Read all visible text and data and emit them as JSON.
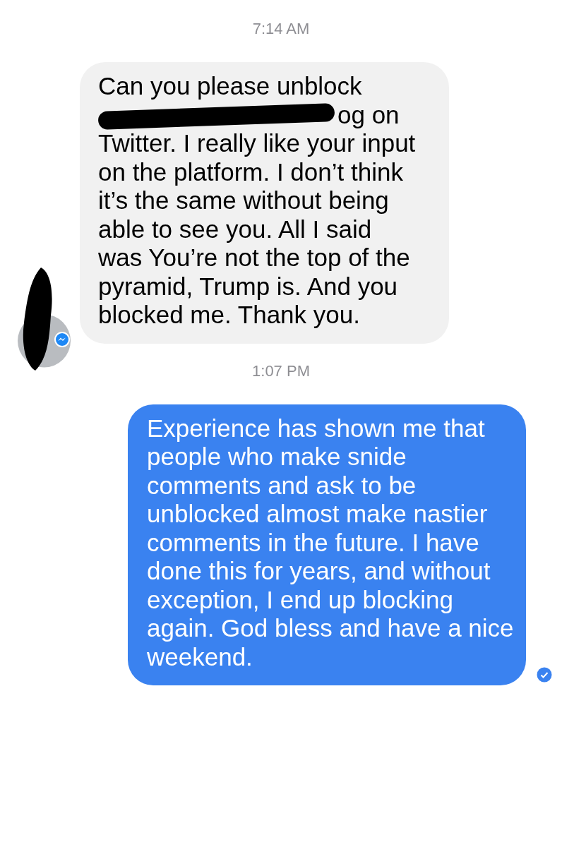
{
  "messages": [
    {
      "kind": "time",
      "text": "7:14 AM"
    },
    {
      "kind": "received",
      "text_before": "Can you please unblock",
      "redacted": true,
      "text_after": "og on Twitter. I really like your input on the platform. I don’t think it’s the same without being able to see you. All I said was You’re not the top of the pyramid, Trump is. And you blocked me. Thank you.",
      "avatar_redacted": true
    },
    {
      "kind": "time",
      "text": "1:07 PM"
    },
    {
      "kind": "sent",
      "text": "Experience has shown me that people who make snide comments and ask to be unblocked almost make nastier comments in the future. I have done this for years, and without exception, I end up blocking again. God bless and have a nice weekend.",
      "delivered": true
    }
  ]
}
